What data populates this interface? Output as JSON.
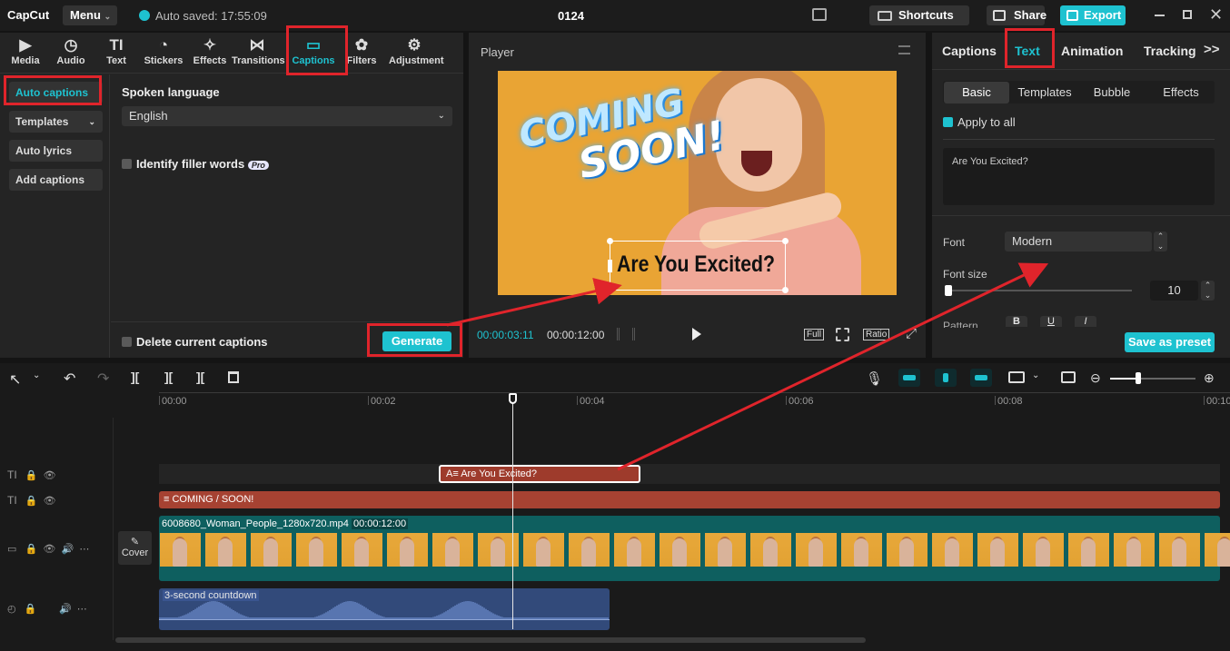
{
  "app": {
    "logo": "CapCut",
    "menu": "Menu",
    "autosaved": "Auto saved: 17:55:09",
    "project_title": "0124",
    "shortcuts": "Shortcuts",
    "share": "Share",
    "export": "Export"
  },
  "tool_tabs": [
    "Media",
    "Audio",
    "Text",
    "Stickers",
    "Effects",
    "Transitions",
    "Captions",
    "Filters",
    "Adjustment"
  ],
  "captions_side": {
    "auto_captions": "Auto captions",
    "templates": "Templates",
    "auto_lyrics": "Auto lyrics",
    "add_captions": "Add captions"
  },
  "captions_main": {
    "spoken_language_label": "Spoken language",
    "spoken_language_value": "English",
    "filler_words": "Identify filler words",
    "pro_badge": "Pro",
    "delete_current": "Delete current captions",
    "generate": "Generate"
  },
  "player": {
    "title": "Player",
    "current_time": "00:00:03:11",
    "total_time": "00:00:12:00",
    "full": "Full",
    "ratio": "Ratio",
    "overlay_line1": "COMING",
    "overlay_line2": "SOON!",
    "caption_text": "Are You Excited?"
  },
  "right_panel": {
    "tabs": [
      "Captions",
      "Text",
      "Animation",
      "Tracking"
    ],
    "subtabs": [
      "Basic",
      "Templates",
      "Bubble",
      "Effects"
    ],
    "apply_to_all": "Apply to all",
    "text_value": "Are You Excited?",
    "font_label": "Font",
    "font_value": "Modern",
    "font_size_label": "Font size",
    "font_size_value": "10",
    "pattern_label": "Pattern",
    "save_preset": "Save as preset"
  },
  "timeline": {
    "ruler": [
      "00:00",
      "00:02",
      "00:04",
      "00:06",
      "00:08",
      "00:10"
    ],
    "caption_clip": "Are You Excited?",
    "text_clip": "COMING / SOON!",
    "video_clip": "6008680_Woman_People_1280x720.mp4",
    "video_duration": "00:00:12:00",
    "audio_clip": "3-second countdown",
    "cover": "Cover",
    "playhead_fraction": 0.338
  },
  "colors": {
    "accent": "#1ec2d0",
    "red_box": "#e0242b",
    "caption_clip": "#9e3b2c",
    "text_clip": "#a64232",
    "video_teal": "#0e5f5f",
    "audio": "#324a7a"
  }
}
